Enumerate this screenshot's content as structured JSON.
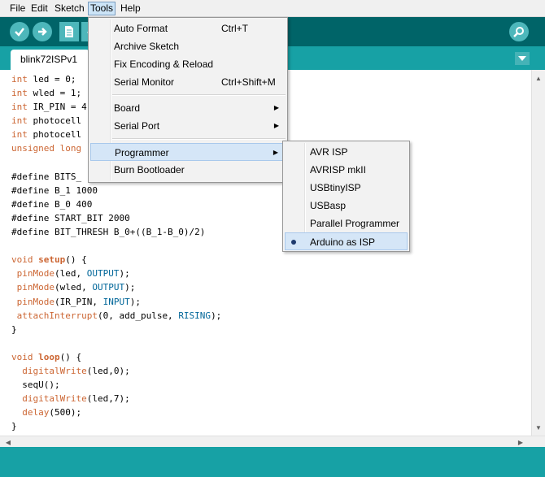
{
  "menubar": {
    "items": [
      {
        "label": "File"
      },
      {
        "label": "Edit"
      },
      {
        "label": "Sketch"
      },
      {
        "label": "Tools"
      },
      {
        "label": "Help"
      }
    ],
    "active": "Tools"
  },
  "toolbar": {
    "buttons": [
      "verify-icon",
      "upload-icon",
      "new-icon",
      "open-icon",
      "save-icon"
    ],
    "serial_monitor_icon": "magnifier-icon"
  },
  "tabs": [
    {
      "label": "blink72ISPv1"
    }
  ],
  "editor": {
    "lines": [
      "int led = 0;",
      "int wled = 1;",
      "int IR_PIN = 4",
      "int photocell",
      "int photocell",
      "unsigned long",
      "",
      "#define BITS_",
      "#define B_1 1000",
      "#define B_0 400",
      "#define START_BIT 2000",
      "#define BIT_THRESH B_0+((B_1-B_0)/2)",
      "",
      "void setup() {",
      " pinMode(led, OUTPUT);",
      " pinMode(wled, OUTPUT);",
      " pinMode(IR_PIN, INPUT);",
      " attachInterrupt(0, add_pulse, RISING);",
      "}",
      "",
      "void loop() {",
      "  digitalWrite(led,0);",
      "  seqU();",
      "  digitalWrite(led,7);",
      "  delay(500);",
      "}"
    ]
  },
  "tools_menu": {
    "items": [
      {
        "label": "Auto Format",
        "shortcut": "Ctrl+T"
      },
      {
        "label": "Archive Sketch"
      },
      {
        "label": "Fix Encoding & Reload"
      },
      {
        "label": "Serial Monitor",
        "shortcut": "Ctrl+Shift+M"
      },
      {
        "label": "Board",
        "submenu": true
      },
      {
        "label": "Serial Port",
        "submenu": true
      },
      {
        "label": "Programmer",
        "submenu": true,
        "highlighted": true
      },
      {
        "label": "Burn Bootloader"
      }
    ],
    "submenu_arrow": "▶"
  },
  "programmer_menu": {
    "items": [
      {
        "label": "AVR ISP"
      },
      {
        "label": "AVRISP mkII"
      },
      {
        "label": "USBtinyISP"
      },
      {
        "label": "USBasp"
      },
      {
        "label": "Parallel Programmer"
      },
      {
        "label": "Arduino as ISP",
        "selected": true
      }
    ]
  },
  "scroll": {
    "up": "▲",
    "down": "▼",
    "left": "◀",
    "right": "▶"
  },
  "colors": {
    "toolbar": "#006468",
    "tabstrip": "#17a1a5",
    "button": "#4db7bb",
    "highlight": "#d5e6f7"
  }
}
